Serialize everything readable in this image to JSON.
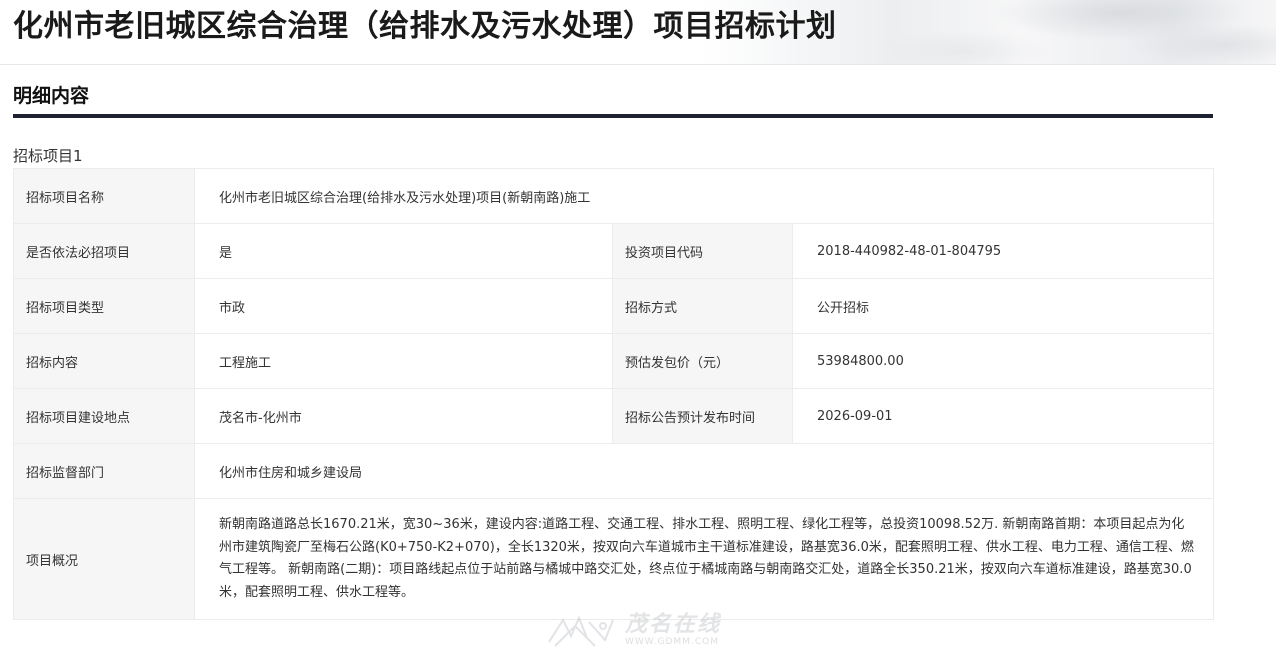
{
  "page": {
    "title": "化州市老旧城区综合治理（给排水及污水处理）项目招标计划"
  },
  "section": {
    "title": "明细内容",
    "subtitle": "招标项目1"
  },
  "details": {
    "project_name_label": "招标项目名称",
    "project_name_value": "化州市老旧城区综合治理(给排水及污水处理)项目(新朝南路)施工",
    "legal_required_label": "是否依法必招项目",
    "legal_required_value": "是",
    "investment_code_label": "投资项目代码",
    "investment_code_value": "2018-440982-48-01-804795",
    "project_type_label": "招标项目类型",
    "project_type_value": "市政",
    "method_label": "招标方式",
    "method_value": "公开招标",
    "content_label": "招标内容",
    "content_value": "工程施工",
    "price_label": "预估发包价（元）",
    "price_value": "53984800.00",
    "location_label": "招标项目建设地点",
    "location_value": "茂名市-化州市",
    "publish_time_label": "招标公告预计发布时间",
    "publish_time_value": "2026-09-01",
    "supervisor_label": "招标监督部门",
    "supervisor_value": "化州市住房和城乡建设局",
    "overview_label": "项目概况",
    "overview_value": "新朝南路道路总长1670.21米，宽30~36米，建设内容:道路工程、交通工程、排水工程、照明工程、绿化工程等，总投资10098.52万. 新朝南路首期：本项目起点为化州市建筑陶瓷厂至梅石公路(K0+750-K2+070)，全长1320米，按双向六车道城市主干道标准建设，路基宽36.0米，配套照明工程、供水工程、电力工程、通信工程、燃气工程等。 新朝南路(二期)：项目路线起点位于站前路与橘城中路交汇处，终点位于橘城南路与朝南路交汇处，道路全长350.21米，按双向六车道标准建设，路基宽30.0米，配套照明工程、供水工程等。"
  },
  "watermark": {
    "text": "茂名在线",
    "url": "WWW.GDMM.COM",
    "icon": "gdmm-logo-icon"
  }
}
